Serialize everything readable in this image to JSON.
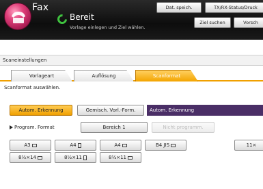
{
  "app": {
    "title": "Fax",
    "icon": "fax-icon"
  },
  "header": {
    "status": "Bereit",
    "status_sub": "Vorlage einlegen und Ziel wählen.",
    "status_color": "#3fc23f",
    "buttons": {
      "dat_speich": "Dat. speich.",
      "tx_rx_status": "TX/RX-Status/Druck",
      "ziel_suchen": "Ziel suchen",
      "vorschau": "Vorsch"
    }
  },
  "section": {
    "title": "Scaneinstellungen"
  },
  "tabs": [
    {
      "label": "Vorlageart",
      "active": false
    },
    {
      "label": "Auflösung",
      "active": false
    },
    {
      "label": "Scanformat",
      "active": true
    }
  ],
  "instruction": "Scanformat auswählen.",
  "options": {
    "autom_erkennung": "Autom. Erkennung",
    "gemischt": "Gemisch. Vorl.-Form.",
    "current_value": "Autom. Erkennung"
  },
  "program": {
    "label": "Program. Format",
    "bereich": "Bereich 1",
    "disabled_button": "Nicht programm."
  },
  "sizes": [
    {
      "label": "A3",
      "orient": "landscape"
    },
    {
      "label": "A4",
      "orient": "portrait"
    },
    {
      "label": "A4",
      "orient": "landscape"
    },
    {
      "label": "B4 JIS",
      "orient": "landscape"
    },
    {
      "label": "11×",
      "orient": ""
    },
    {
      "label": "8½×14",
      "orient": "landscape"
    },
    {
      "label": "8½×11",
      "orient": "portrait"
    },
    {
      "label": "8½×11",
      "orient": "landscape"
    }
  ],
  "colors": {
    "accent": "#f0a000",
    "selected_bg": "#4a2e66",
    "titlebar": "#111111"
  }
}
